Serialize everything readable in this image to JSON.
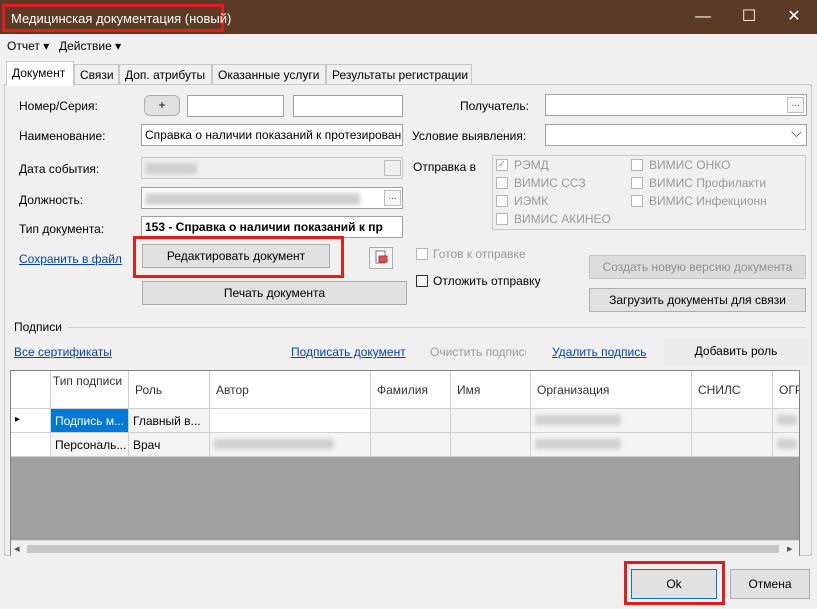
{
  "window": {
    "title": "Медицинская документация (новый)",
    "minimize": "—",
    "maximize": "☐",
    "close": "✕"
  },
  "menu": {
    "report": "Отчет",
    "action": "Действие",
    "arrow": "▾"
  },
  "tabs": [
    {
      "label": "Документ",
      "active": true
    },
    {
      "label": "Связи"
    },
    {
      "label": "Доп. атрибуты"
    },
    {
      "label": "Оказанные услуги"
    },
    {
      "label": "Результаты регистрации"
    }
  ],
  "form": {
    "number_label": "Номер/Серия:",
    "plus": "+",
    "name_label": "Наименование:",
    "name_value": "Справка о наличии показаний к протезирован",
    "event_date_label": "Дата события:",
    "position_label": "Должность:",
    "doctype_label": "Тип документа:",
    "doctype_value": "153 - Справка о наличии показаний к пр",
    "save_link": "Сохранить в файл",
    "edit_button": "Редактировать документ",
    "print_button": "Печать документа",
    "recipient_label": "Получатель:",
    "condition_label": "Условие выявления:",
    "ellipsis": "...",
    "dropdown_arrow": "⌵"
  },
  "send": {
    "label": "Отправка в",
    "options": [
      {
        "label": "РЭМД",
        "checked": true
      },
      {
        "label": "ВИМИС ССЗ"
      },
      {
        "label": "ИЭМК"
      },
      {
        "label": "ВИМИС АКИНЕО"
      },
      {
        "label": "ВИМИС ОНКО"
      },
      {
        "label": "ВИМИС Профилакти"
      },
      {
        "label": "ВИМИС Инфекционн"
      }
    ],
    "ready_label": "Готов к отправке",
    "postpone_label": "Отложить отправку",
    "new_version_button": "Создать новую версию документа",
    "upload_button": "Загрузить документы для связи",
    "check_mark": "✓"
  },
  "signatures": {
    "section_label": "Подписи",
    "all_certs": "Все сертификаты",
    "sign": "Подписать документ",
    "clear": "Очистить подписи",
    "delete": "Удалить подпись",
    "add_role": "Добавить роль",
    "columns": [
      "Тип подписи",
      "Роль",
      "Автор",
      "Фамилия",
      "Имя",
      "Организация",
      "СНИЛС",
      "ОГР"
    ],
    "rows": [
      {
        "type": "Подпись м...",
        "role": "Главный в..."
      },
      {
        "type": "Персональ...",
        "role": "Врач"
      }
    ],
    "row_marker": "▸",
    "scroll_left": "◂",
    "scroll_right": "▸"
  },
  "footer": {
    "ok": "Ok",
    "cancel": "Отмена"
  }
}
